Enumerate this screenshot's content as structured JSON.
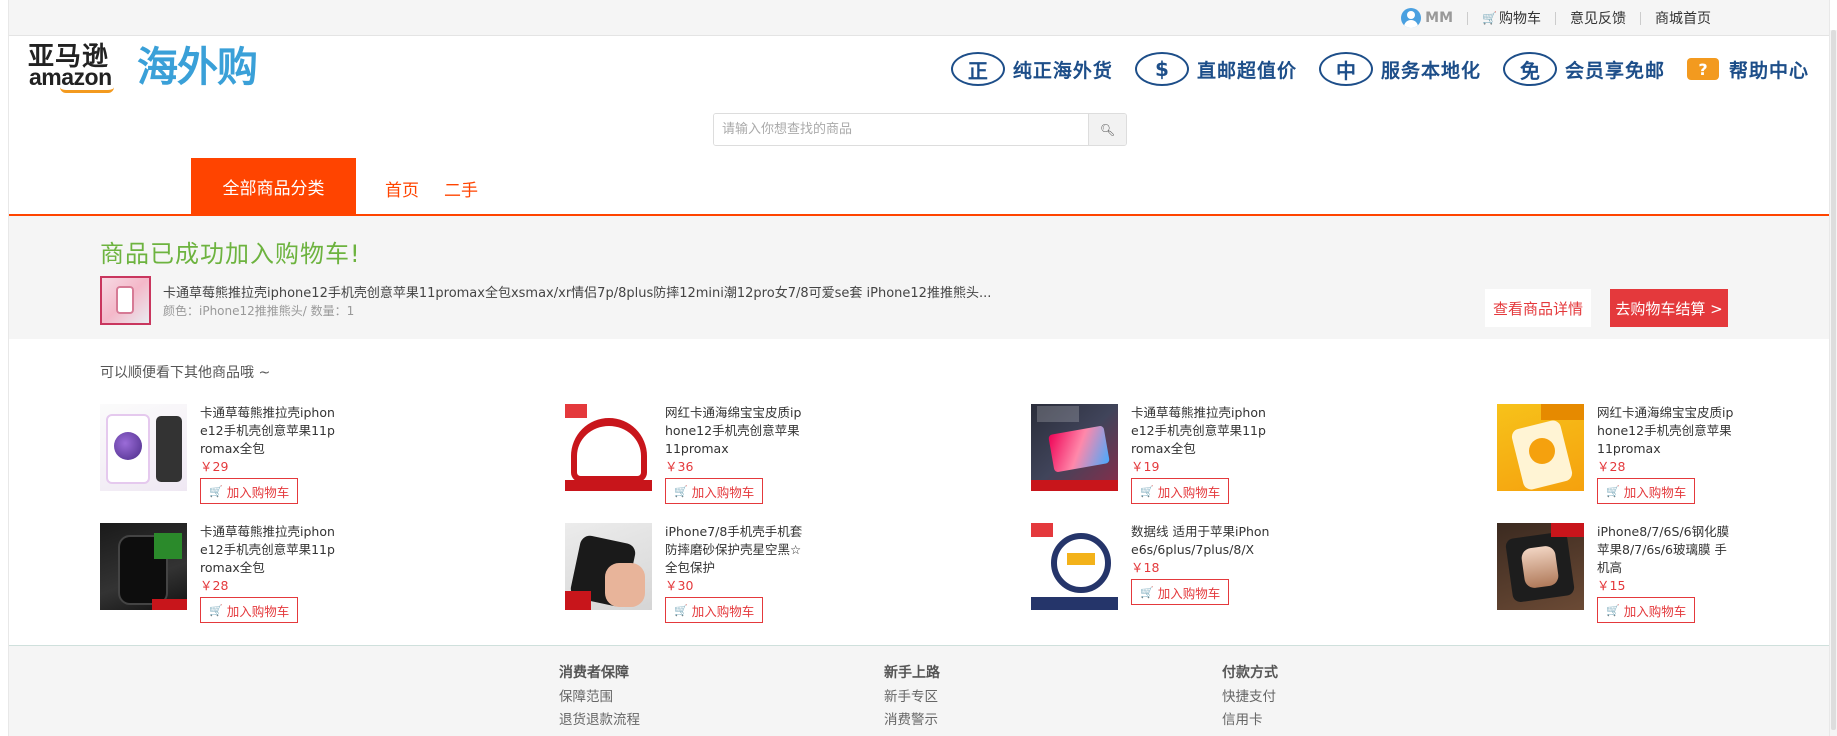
{
  "topbar": {
    "user": "MM",
    "cart": "购物车",
    "feedback": "意见反馈",
    "home": "商城首页"
  },
  "logo": {
    "cn_small": "亚马逊",
    "amazon": "amazon",
    "cn_big": "海外购"
  },
  "features": [
    {
      "badge": "正",
      "label": "纯正海外货"
    },
    {
      "badge": "$",
      "label": "直邮超值价"
    },
    {
      "badge": "中",
      "label": "服务本地化"
    },
    {
      "badge": "免",
      "label": "会员享免邮"
    },
    {
      "badge": "?",
      "label": "帮助中心"
    }
  ],
  "search": {
    "placeholder": "请输入你想查找的商品",
    "icon": "search-icon"
  },
  "nav": {
    "all_categories": "全部商品分类",
    "home": "首页",
    "second_hand": "二手"
  },
  "success": {
    "title": "商品已成功加入购物车!",
    "product_name": "卡通草莓熊推拉壳iphone12手机壳创意苹果11promax全包xsmax/xr情侣7p/8plus防摔12mini潮12pro女7/8可爱se套 iPhone12推推熊头...",
    "product_meta": "颜色：iPhone12推推熊头/ 数量：1",
    "detail_button": "查看商品详情",
    "checkout_button": "去购物车结算 >"
  },
  "recommend": {
    "title": "可以顺便看下其他商品哦 ~",
    "add_label": "加入购物车",
    "items": [
      {
        "name": "卡通草莓熊推拉壳iphone12手机壳创意苹果11promax全包",
        "price": "￥29"
      },
      {
        "name": "网红卡通海绵宝宝皮质iphone12手机壳创意苹果11promax",
        "price": "￥36"
      },
      {
        "name": "卡通草莓熊推拉壳iphone12手机壳创意苹果11promax全包",
        "price": "￥19"
      },
      {
        "name": "网红卡通海绵宝宝皮质iphone12手机壳创意苹果11promax",
        "price": "￥28"
      },
      {
        "name": "卡通草莓熊推拉壳iphone12手机壳创意苹果11promax全包",
        "price": "￥28"
      },
      {
        "name": "iPhone7/8手机壳手机套防摔磨砂保护壳星空黑☆全包保护",
        "price": "￥30"
      },
      {
        "name": "数据线 适用于苹果iPhone6s/6plus/7plus/8/X",
        "price": "￥18"
      },
      {
        "name": "iPhone8/7/6S/6钢化膜 苹果8/7/6s/6玻璃膜 手机高",
        "price": "￥15"
      }
    ]
  },
  "footer": {
    "columns": [
      {
        "title": "消费者保障",
        "links": [
          "保障范围",
          "退货退款流程"
        ]
      },
      {
        "title": "新手上路",
        "links": [
          "新手专区",
          "消费警示"
        ]
      },
      {
        "title": "付款方式",
        "links": [
          "快捷支付",
          "信用卡"
        ]
      }
    ]
  },
  "colors": {
    "accent": "#ff4400",
    "price_red": "#e4393c",
    "success_green": "#6db33f",
    "brand_blue": "#1d4e89"
  }
}
